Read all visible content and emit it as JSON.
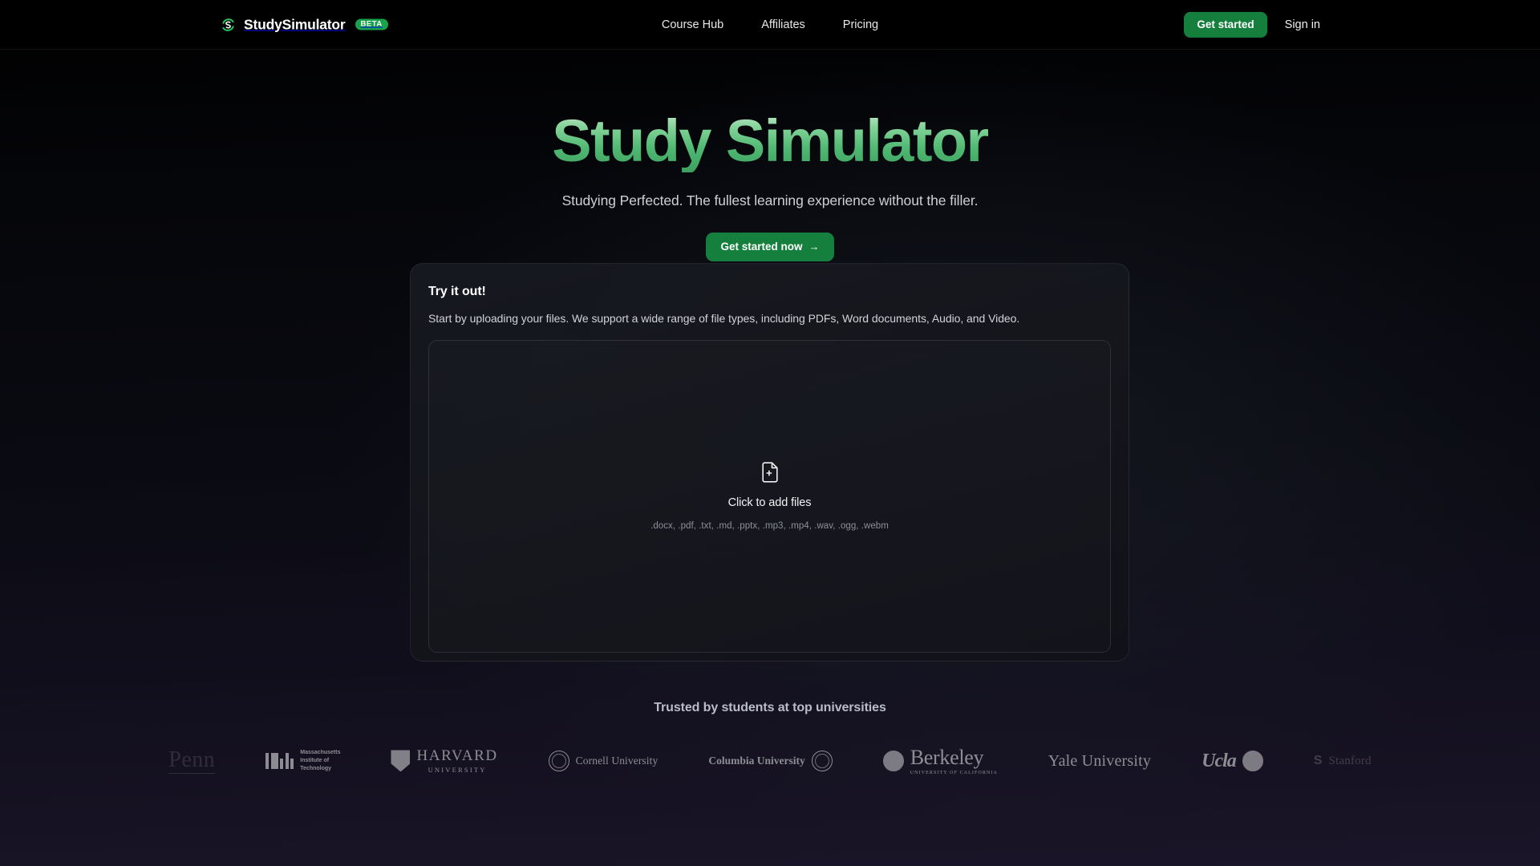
{
  "header": {
    "brand_name": "StudySimulator",
    "brand_icon": "refresh-s-logo-icon",
    "beta_label": "BETA",
    "nav": [
      {
        "label": "Course Hub"
      },
      {
        "label": "Affiliates"
      },
      {
        "label": "Pricing"
      }
    ],
    "get_started_label": "Get started",
    "sign_in_label": "Sign in"
  },
  "hero": {
    "title": "Study Simulator",
    "subtitle": "Studying Perfected. The fullest learning experience without the filler.",
    "cta_label": "Get started now",
    "cta_arrow": "→"
  },
  "try_card": {
    "title": "Try it out!",
    "description": "Start by uploading your files. We support a wide range of file types, including PDFs, Word documents, Audio, and Video.",
    "dropzone": {
      "icon": "file-plus-icon",
      "label": "Click to add files",
      "accepted_types": ".docx, .pdf, .txt, .md, .pptx, .mp3, .mp4, .wav, .ogg, .webm"
    }
  },
  "trusted": {
    "title": "Trusted by students at top universities",
    "logos": [
      {
        "name": "Penn",
        "style": "penn"
      },
      {
        "name": "Massachusetts Institute of Technology",
        "style": "mit",
        "line1": "Massachusetts",
        "line2": "Institute of",
        "line3": "Technology"
      },
      {
        "name": "Harvard University",
        "style": "harvard",
        "line1": "HARVARD",
        "line2": "UNIVERSITY"
      },
      {
        "name": "Cornell University",
        "style": "cornell"
      },
      {
        "name": "Columbia University",
        "style": "columbia"
      },
      {
        "name": "Berkeley",
        "style": "berkeley",
        "line1": "Berkeley",
        "line2": "UNIVERSITY OF CALIFORNIA"
      },
      {
        "name": "Yale University",
        "style": "yale"
      },
      {
        "name": "Ucla",
        "style": "ucla"
      },
      {
        "name": "Stanford",
        "style": "stanford",
        "mark": "S"
      }
    ]
  },
  "colors": {
    "accent_green": "#15803d",
    "badge_green": "#16a34a",
    "title_gradient_top": "#cfe9d6",
    "title_gradient_bottom": "#3da05f",
    "page_background": "#000000"
  }
}
